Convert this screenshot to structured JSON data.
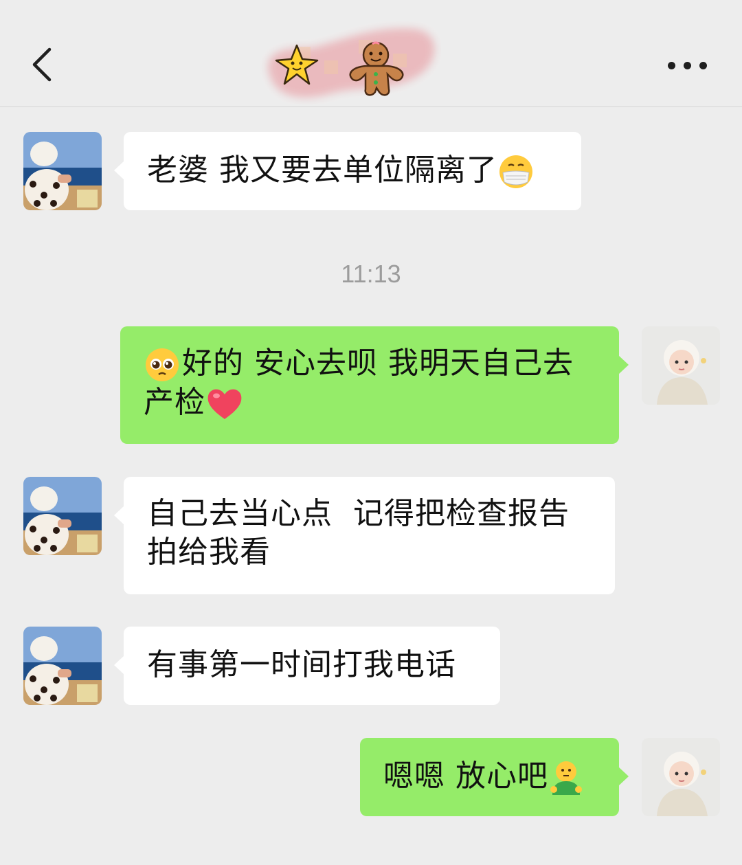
{
  "header": {
    "back_icon": "chevron-left-icon",
    "title_sticker_icon": "star-and-gingerbread-sticker",
    "more_icon": "ellipsis-icon"
  },
  "messages": [
    {
      "side": "incoming",
      "text": "老婆 我又要去单位隔离了",
      "emoji": "face-with-medical-mask-emoji"
    },
    {
      "type": "timestamp",
      "text": "11:13"
    },
    {
      "side": "outgoing",
      "line1": "好的 安心去呗 我明天自己去",
      "line2": "产检",
      "emoji_start": "pleading-face-emoji",
      "emoji_end": "red-heart-emoji"
    },
    {
      "side": "incoming",
      "line1": "自己去当心点  记得把检查报告",
      "line2": "拍给我看"
    },
    {
      "side": "incoming",
      "text": "有事第一时间打我电话"
    },
    {
      "side": "outgoing",
      "text": "嗯嗯 放心吧",
      "emoji": "person-in-green-shirt-emoji"
    }
  ],
  "colors": {
    "background": "#ededed",
    "incoming_bubble": "#ffffff",
    "outgoing_bubble": "#95ec69",
    "timestamp": "#9c9c9c"
  }
}
